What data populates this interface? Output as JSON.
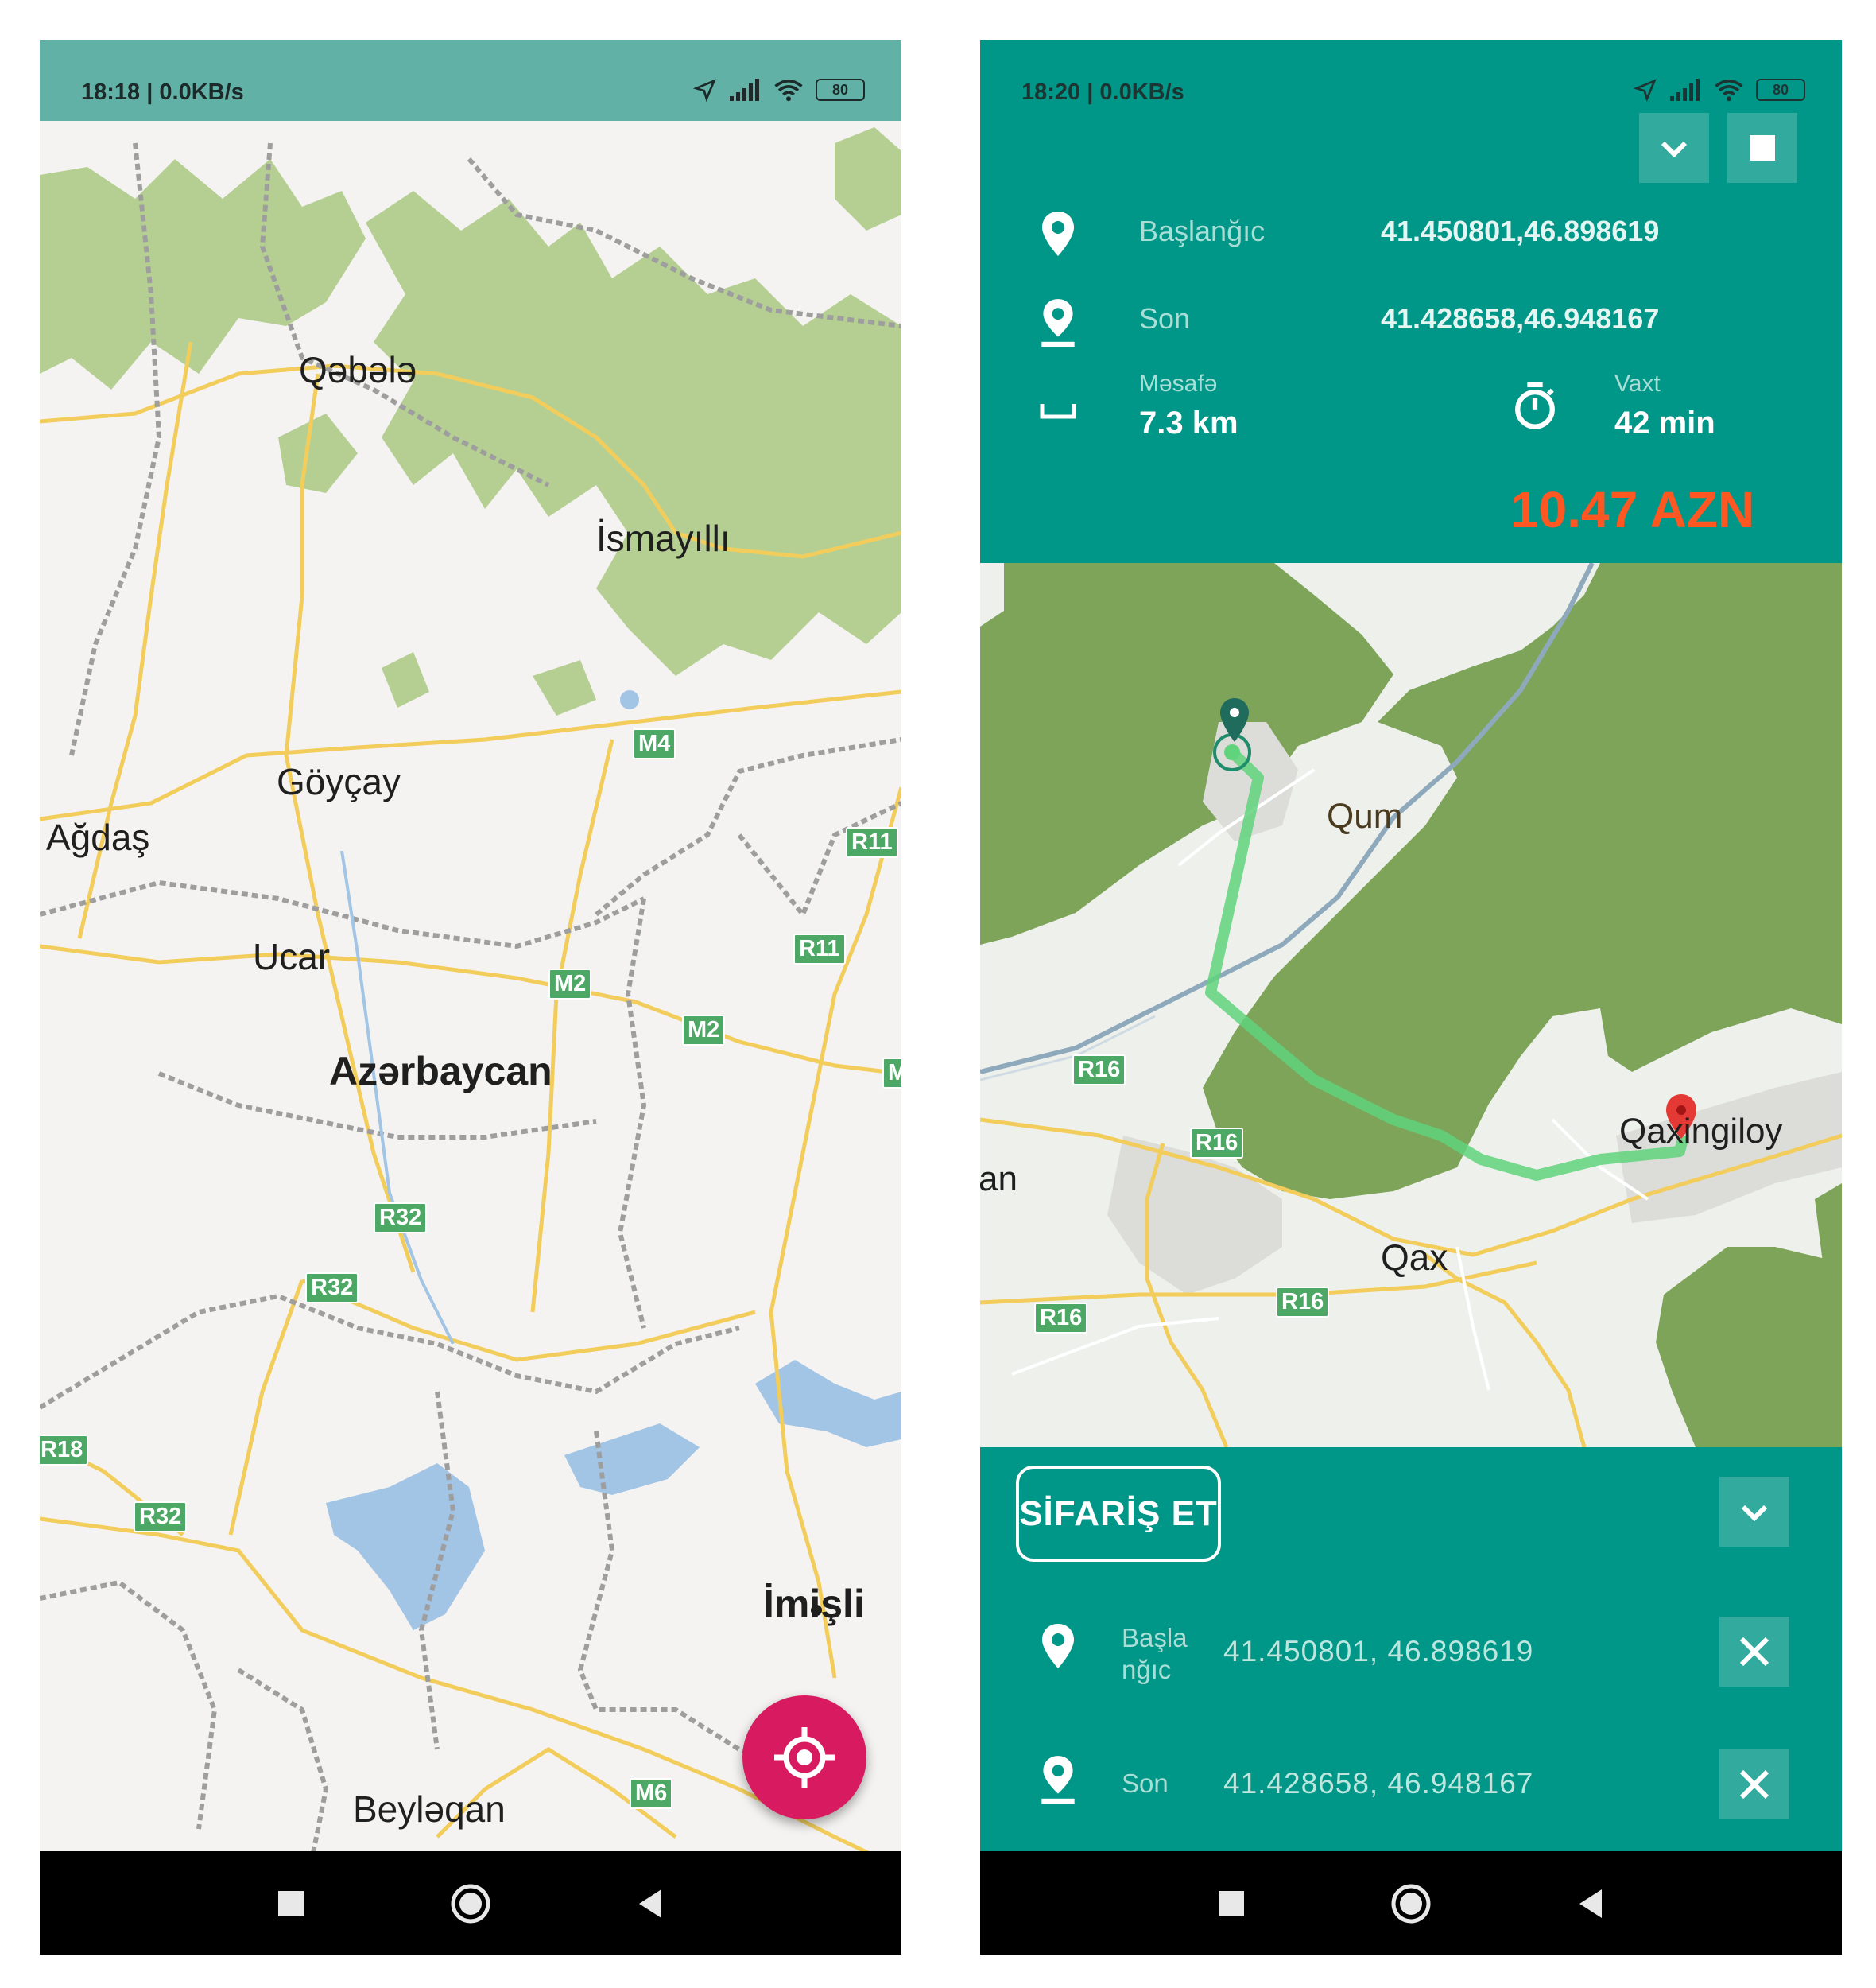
{
  "left_screen": {
    "status_bar": {
      "time": "18:18 | 0.0KB/s",
      "battery": "80"
    },
    "map": {
      "place_labels": {
        "qabala": "Qəbələ",
        "ismayilli": "İsmayıllı",
        "goycay": "Göyçay",
        "agdas": "Ağdaş",
        "ucar": "Ucar",
        "country": "Azərbaycan",
        "imisli": "İmişli",
        "beylaqan": "Beyləqan"
      },
      "road_badges": {
        "m4": "M4",
        "r11a": "R11",
        "r11b": "R11",
        "m2a": "M2",
        "m2b": "M2",
        "m_edge": "M",
        "r32a": "R32",
        "r32b": "R32",
        "r32c": "R32",
        "r18": "R18",
        "m6": "M6"
      }
    },
    "fab": {
      "icon": "my-location-icon"
    }
  },
  "right_screen": {
    "status_bar": {
      "time": "18:20 | 0.0KB/s",
      "battery": "80"
    },
    "header_buttons": {
      "collapse_icon": "chevron-down-icon",
      "stop_icon": "stop-square-icon"
    },
    "trip_info": {
      "start_label": "Başlanğıc",
      "start_value": "41.450801,46.898619",
      "end_label": "Son",
      "end_value": "41.428658,46.948167",
      "distance_label": "Məsafə",
      "distance_value": "7.3 km",
      "time_label": "Vaxt",
      "time_value": "42 min",
      "price": "10.47 AZN"
    },
    "map": {
      "place_labels": {
        "qum": "Qum",
        "qax": "Qax",
        "qaxingiloy": "Qaxingiloy",
        "edge": "an"
      },
      "road_badges": {
        "r16a": "R16",
        "r16b": "R16",
        "r16c": "R16",
        "r16d": "R16"
      }
    },
    "order_panel": {
      "order_button": "SİFARİŞ ET",
      "start_label": "Başla\nnğıc",
      "start_value": "41.450801, 46.898619",
      "end_label": "Son",
      "end_value": "41.428658, 46.948167"
    }
  },
  "colors": {
    "teal_primary": "#009688",
    "price_orange": "#ff5722",
    "fab_pink": "#d81b60",
    "route_green": "#5fd47c",
    "forest_green": "#7ea45a"
  }
}
